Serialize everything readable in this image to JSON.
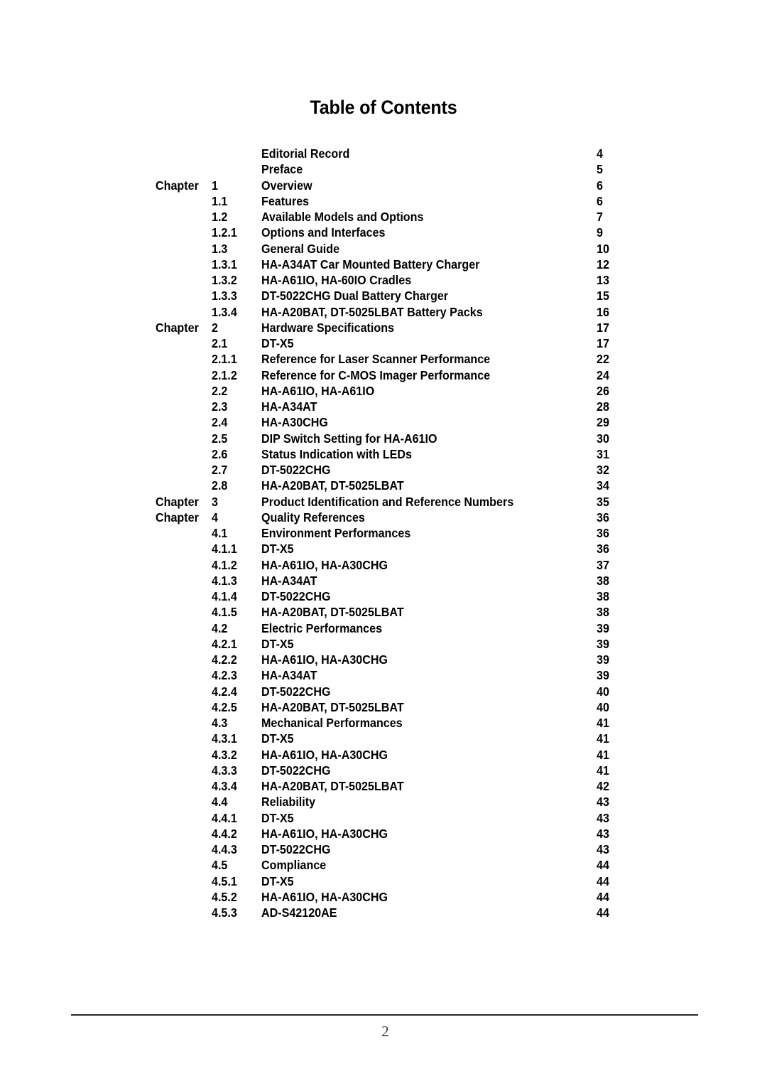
{
  "document": {
    "title": "Table of Contents",
    "footer_page_number": "2"
  },
  "columns": {
    "chapter_label": "Chapter"
  },
  "entries": [
    {
      "chapter": "",
      "number": "",
      "title": "Editorial Record",
      "page": "4"
    },
    {
      "chapter": "",
      "number": "",
      "title": "Preface",
      "page": "5"
    },
    {
      "chapter": "Chapter",
      "number": "1",
      "title": "Overview",
      "page": "6"
    },
    {
      "chapter": "",
      "number": "1.1",
      "title": "Features",
      "page": "6"
    },
    {
      "chapter": "",
      "number": "1.2",
      "title": "Available Models and Options",
      "page": "7"
    },
    {
      "chapter": "",
      "number": "1.2.1",
      "title": "Options and Interfaces",
      "page": "9"
    },
    {
      "chapter": "",
      "number": "1.3",
      "title": "General Guide",
      "page": "10"
    },
    {
      "chapter": "",
      "number": "1.3.1",
      "title": "HA-A34AT Car Mounted Battery Charger",
      "page": "12"
    },
    {
      "chapter": "",
      "number": "1.3.2",
      "title": "HA-A61IO, HA-60IO Cradles",
      "page": "13"
    },
    {
      "chapter": "",
      "number": "1.3.3",
      "title": "DT-5022CHG Dual Battery Charger",
      "page": "15"
    },
    {
      "chapter": "",
      "number": "1.3.4",
      "title": "HA-A20BAT, DT-5025LBAT Battery Packs",
      "page": "16"
    },
    {
      "chapter": "Chapter",
      "number": "2",
      "title": "Hardware Specifications",
      "page": "17"
    },
    {
      "chapter": "",
      "number": "2.1",
      "title": "DT-X5",
      "page": "17"
    },
    {
      "chapter": "",
      "number": "2.1.1",
      "title": "Reference for Laser Scanner Performance",
      "page": "22"
    },
    {
      "chapter": "",
      "number": "2.1.2",
      "title": "Reference for C-MOS Imager Performance",
      "page": "24"
    },
    {
      "chapter": "",
      "number": "2.2",
      "title": "HA-A61IO, HA-A61IO",
      "page": "26"
    },
    {
      "chapter": "",
      "number": "2.3",
      "title": "HA-A34AT",
      "page": "28"
    },
    {
      "chapter": "",
      "number": "2.4",
      "title": "HA-A30CHG",
      "page": "29"
    },
    {
      "chapter": "",
      "number": "2.5",
      "title": "DIP Switch Setting for HA-A61IO",
      "page": "30"
    },
    {
      "chapter": "",
      "number": "2.6",
      "title": "Status Indication with LEDs",
      "page": "31"
    },
    {
      "chapter": "",
      "number": "2.7",
      "title": "DT-5022CHG",
      "page": "32"
    },
    {
      "chapter": "",
      "number": "2.8",
      "title": "HA-A20BAT, DT-5025LBAT",
      "page": "34"
    },
    {
      "chapter": "Chapter",
      "number": "3",
      "title": "Product Identification and Reference Numbers",
      "page": "35"
    },
    {
      "chapter": "Chapter",
      "number": "4",
      "title": "Quality References",
      "page": "36"
    },
    {
      "chapter": "",
      "number": "4.1",
      "title": "Environment Performances",
      "page": "36"
    },
    {
      "chapter": "",
      "number": "4.1.1",
      "title": "DT-X5",
      "page": "36"
    },
    {
      "chapter": "",
      "number": "4.1.2",
      "title": "HA-A61IO, HA-A30CHG",
      "page": "37"
    },
    {
      "chapter": "",
      "number": "4.1.3",
      "title": "HA-A34AT",
      "page": "38"
    },
    {
      "chapter": "",
      "number": "4.1.4",
      "title": "DT-5022CHG",
      "page": "38"
    },
    {
      "chapter": "",
      "number": "4.1.5",
      "title": "HA-A20BAT, DT-5025LBAT",
      "page": "38"
    },
    {
      "chapter": "",
      "number": "4.2",
      "title": "Electric Performances",
      "page": "39"
    },
    {
      "chapter": "",
      "number": "4.2.1",
      "title": "DT-X5",
      "page": "39"
    },
    {
      "chapter": "",
      "number": "4.2.2",
      "title": "HA-A61IO, HA-A30CHG",
      "page": "39"
    },
    {
      "chapter": "",
      "number": "4.2.3",
      "title": "HA-A34AT",
      "page": "39"
    },
    {
      "chapter": "",
      "number": "4.2.4",
      "title": "DT-5022CHG",
      "page": "40"
    },
    {
      "chapter": "",
      "number": "4.2.5",
      "title": "HA-A20BAT, DT-5025LBAT",
      "page": "40"
    },
    {
      "chapter": "",
      "number": "4.3",
      "title": "Mechanical Performances",
      "page": "41"
    },
    {
      "chapter": "",
      "number": "4.3.1",
      "title": "DT-X5",
      "page": "41"
    },
    {
      "chapter": "",
      "number": "4.3.2",
      "title": "HA-A61IO, HA-A30CHG",
      "page": "41"
    },
    {
      "chapter": "",
      "number": "4.3.3",
      "title": "DT-5022CHG",
      "page": "41"
    },
    {
      "chapter": "",
      "number": "4.3.4",
      "title": "HA-A20BAT, DT-5025LBAT",
      "page": "42"
    },
    {
      "chapter": "",
      "number": "4.4",
      "title": "Reliability",
      "page": "43"
    },
    {
      "chapter": "",
      "number": "4.4.1",
      "title": "DT-X5",
      "page": "43"
    },
    {
      "chapter": "",
      "number": "4.4.2",
      "title": "HA-A61IO, HA-A30CHG",
      "page": "43"
    },
    {
      "chapter": "",
      "number": "4.4.3",
      "title": "DT-5022CHG",
      "page": "43"
    },
    {
      "chapter": "",
      "number": "4.5",
      "title": "Compliance",
      "page": "44"
    },
    {
      "chapter": "",
      "number": "4.5.1",
      "title": "DT-X5",
      "page": "44"
    },
    {
      "chapter": "",
      "number": "4.5.2",
      "title": "HA-A61IO, HA-A30CHG",
      "page": "44"
    },
    {
      "chapter": "",
      "number": "4.5.3",
      "title": "AD-S42120AE",
      "page": "44"
    }
  ]
}
